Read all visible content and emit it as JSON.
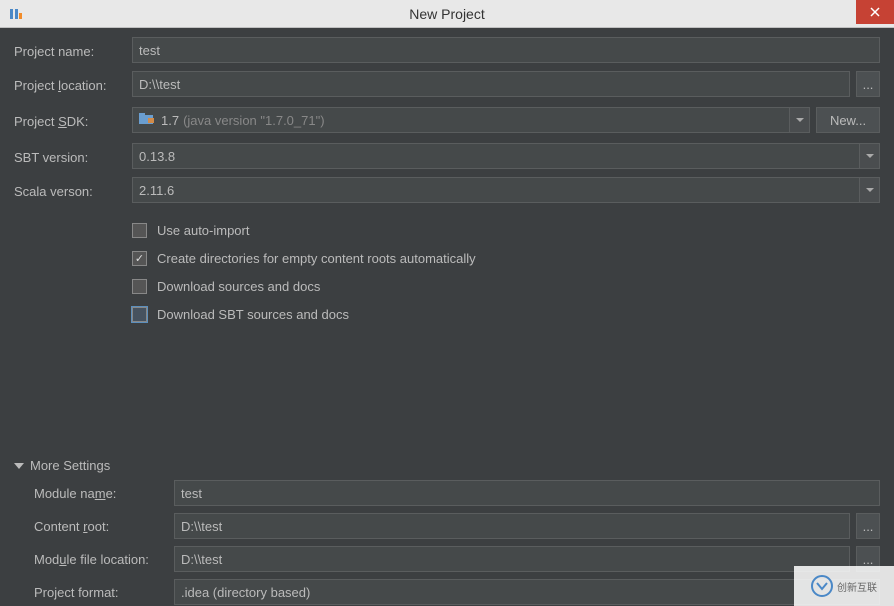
{
  "window": {
    "title": "New Project"
  },
  "labels": {
    "project_name": "Project name:",
    "project_location_pre": "Project ",
    "project_location_u": "l",
    "project_location_post": "ocation:",
    "project_sdk_pre": "Project ",
    "project_sdk_u": "S",
    "project_sdk_post": "DK:",
    "sbt_version": "SBT version:",
    "scala_version": "Scala verson:",
    "more_settings": "More Settings",
    "module_name_pre": "Module na",
    "module_name_u": "m",
    "module_name_post": "e:",
    "content_root_pre": "Content ",
    "content_root_u": "r",
    "content_root_post": "oot:",
    "module_file_pre": "Mod",
    "module_file_u": "u",
    "module_file_post": "le file location:",
    "project_format": "Project format:"
  },
  "values": {
    "project_name": "test",
    "project_location": "D:\\\\test",
    "sdk_main": "1.7",
    "sdk_detail": "(java version \"1.7.0_71\")",
    "sbt_version": "0.13.8",
    "scala_version": "2.11.6",
    "module_name": "test",
    "content_root": "D:\\\\test",
    "module_file_location": "D:\\\\test",
    "project_format": ".idea (directory based)"
  },
  "buttons": {
    "browse": "...",
    "new": "New..."
  },
  "checks": {
    "auto_import": "Use auto-import",
    "create_dirs": "Create directories for empty content roots automatically",
    "download_sources": "Download sources and docs",
    "download_sbt": "Download SBT sources and docs"
  },
  "watermark": "创新互联"
}
